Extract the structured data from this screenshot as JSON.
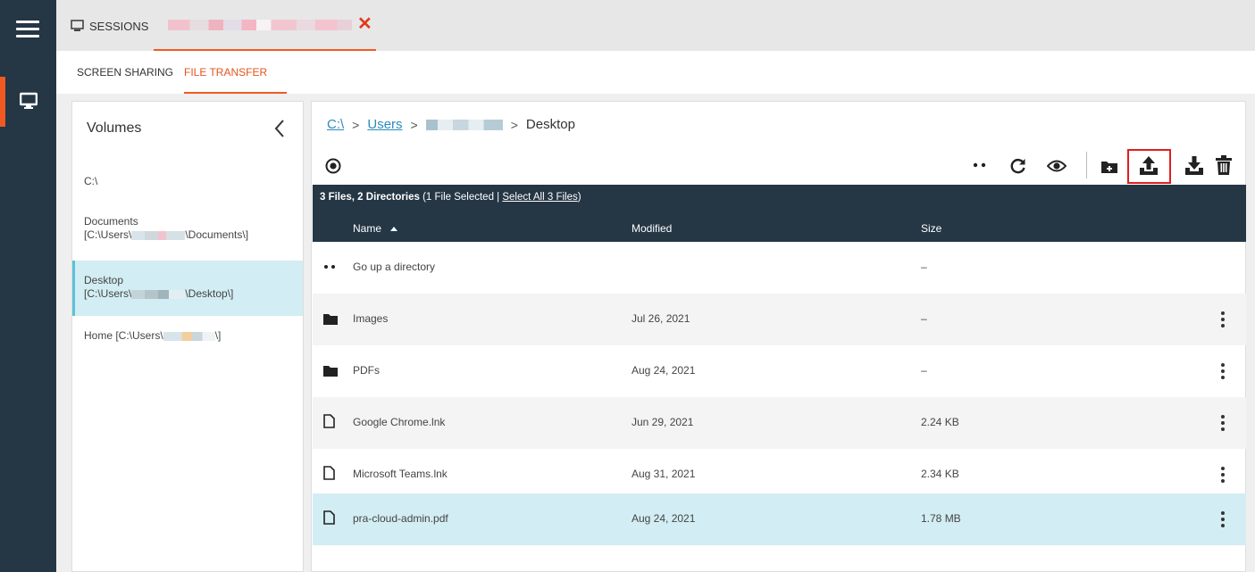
{
  "nav": {
    "menu_icon": "hamburger-menu-icon",
    "sessions_icon": "monitor-icon",
    "accent_color": "#f05a22",
    "rail_color": "#253645"
  },
  "top_bar": {
    "sessions_label": "SESSIONS",
    "session_close": "✕"
  },
  "sub_tabs": {
    "screen_sharing": "SCREEN SHARING",
    "file_transfer": "FILE TRANSFER",
    "active": "FILE TRANSFER"
  },
  "volumes": {
    "title": "Volumes",
    "items": [
      {
        "name": "C:\\",
        "path": ""
      },
      {
        "name": "Documents",
        "path_prefix": "[C:\\Users\\",
        "path_suffix": "\\Documents\\]"
      },
      {
        "name": "Desktop",
        "path_prefix": "[C:\\Users\\",
        "path_suffix": "\\Desktop\\]",
        "selected": true
      },
      {
        "name": "Home [C:\\Users\\",
        "path_suffix": "\\]"
      }
    ]
  },
  "breadcrumb": {
    "root": "C:\\",
    "users": "Users",
    "current": "Desktop"
  },
  "toolbar": {
    "icons": [
      "stop-icon",
      "go-up-icon",
      "refresh-icon",
      "view-icon",
      "new-folder-icon",
      "upload-icon",
      "download-icon",
      "delete-icon"
    ],
    "highlighted": "upload-icon",
    "highlight_color": "#e01e1e"
  },
  "table": {
    "summary_counts": "3 Files, 2 Directories",
    "summary_selected": "(1 File Selected | ",
    "select_all": "Select All 3 Files",
    "summary_close": ")",
    "columns": {
      "name": "Name",
      "modified": "Modified",
      "size": "Size"
    },
    "rows": [
      {
        "icon": "two-dots-icon",
        "name": "Go up a directory",
        "modified": "",
        "size": "–"
      },
      {
        "icon": "folder-icon",
        "name": "Images",
        "modified": "Jul 26, 2021",
        "size": "–"
      },
      {
        "icon": "folder-icon",
        "name": "PDFs",
        "modified": "Aug 24, 2021",
        "size": "–"
      },
      {
        "icon": "file-icon",
        "name": "Google Chrome.lnk",
        "modified": "Jun 29, 2021",
        "size": "2.24 KB"
      },
      {
        "icon": "file-icon",
        "name": "Microsoft Teams.lnk",
        "modified": "Aug 31, 2021",
        "size": "2.34 KB"
      },
      {
        "icon": "file-icon",
        "name": "pra-cloud-admin.pdf",
        "modified": "Aug 24, 2021",
        "size": "1.78 MB",
        "selected": true
      }
    ]
  }
}
